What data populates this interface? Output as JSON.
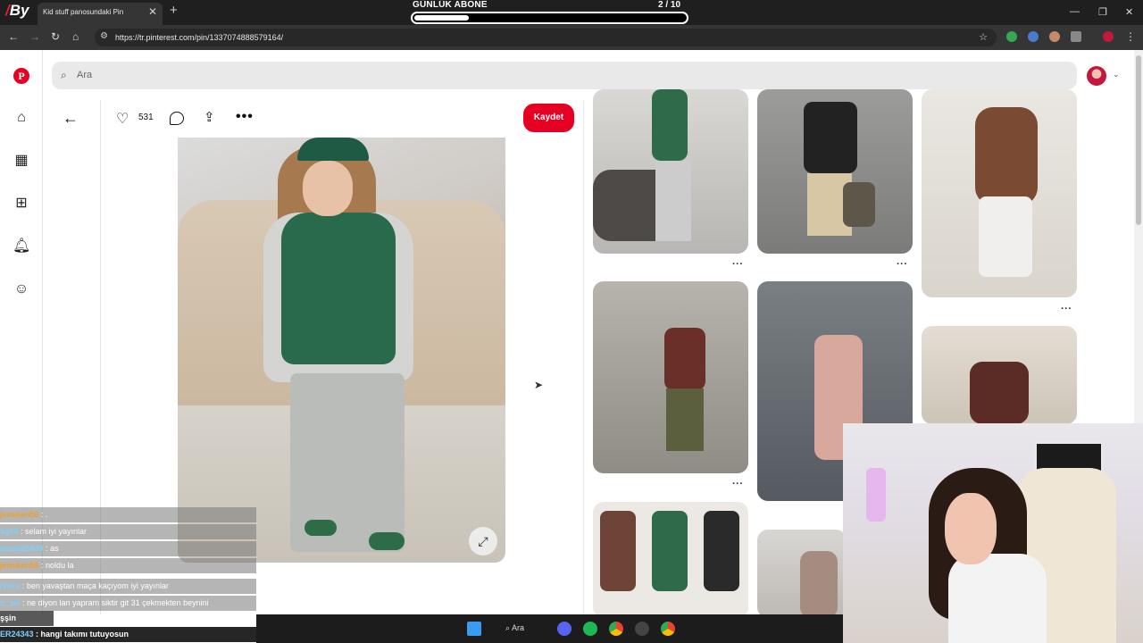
{
  "browser": {
    "tab_title": "Kid stuff panosundaki Pin",
    "url": "https://tr.pinterest.com/pin/1337074888579164/",
    "logo_text": "By"
  },
  "subscriber_goal": {
    "label": "GÜNLÜK ABONE",
    "count_text": "2 / 10",
    "progress": 0.2
  },
  "search": {
    "placeholder": "Ara"
  },
  "pin": {
    "likes": "531",
    "save_label": "Kaydet"
  },
  "chat": [
    {
      "user": "jensken56",
      "message": ": ."
    },
    {
      "user": "sg00",
      "message": ": selam iyi yayınlar"
    },
    {
      "user": "ekodal5539",
      "message": ": as"
    },
    {
      "user": "jensken56",
      "message": ": noldu la"
    },
    {
      "user": "iYoru",
      "message": ": ben yavaştan maça kaçıyom iyi yayınlar"
    },
    {
      "user": "n_sw",
      "message": ": ne diyon lan yapram siktir git 31 çekmekten beynini"
    },
    {
      "user": "",
      "message": "şşin"
    },
    {
      "user": "ER24343",
      "message": ": hangi takımı tutuyosun"
    }
  ],
  "taskbar": {
    "search_label": "Ara"
  },
  "colors": {
    "pinterest_red": "#e60023",
    "chrome_dark": "#1f1f1f"
  }
}
